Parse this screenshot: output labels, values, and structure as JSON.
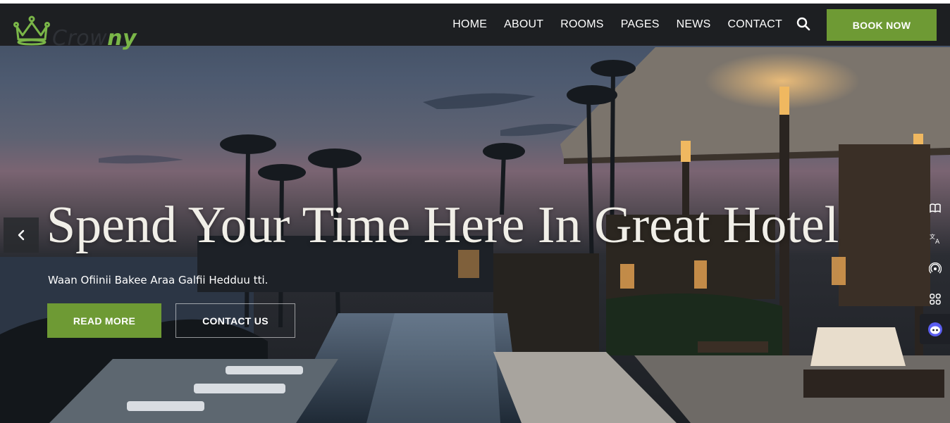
{
  "brand": {
    "name_part1": "Crow",
    "name_part2": "ny",
    "accent": "#7ab648"
  },
  "nav": {
    "items": [
      {
        "label": "HOME"
      },
      {
        "label": "ABOUT"
      },
      {
        "label": "ROOMS"
      },
      {
        "label": "PAGES"
      },
      {
        "label": "NEWS"
      },
      {
        "label": "CONTACT"
      }
    ],
    "search_icon": "search-icon",
    "book_label": "BOOK NOW",
    "book_color": "#6e9a34"
  },
  "hero": {
    "headline": "Spend Your Time Here In Great Hotel",
    "subline": "Waan Ofiinii Bakee Araa Galfii Hedduu tti.",
    "read_more_label": "READ MORE",
    "contact_label": "CONTACT US",
    "prev_icon": "chevron-left-icon"
  },
  "side_tools": [
    {
      "icon": "book-icon"
    },
    {
      "icon": "translate-icon"
    },
    {
      "icon": "broadcast-icon"
    },
    {
      "icon": "apps-grid-icon"
    },
    {
      "icon": "assistant-bot-icon"
    }
  ]
}
